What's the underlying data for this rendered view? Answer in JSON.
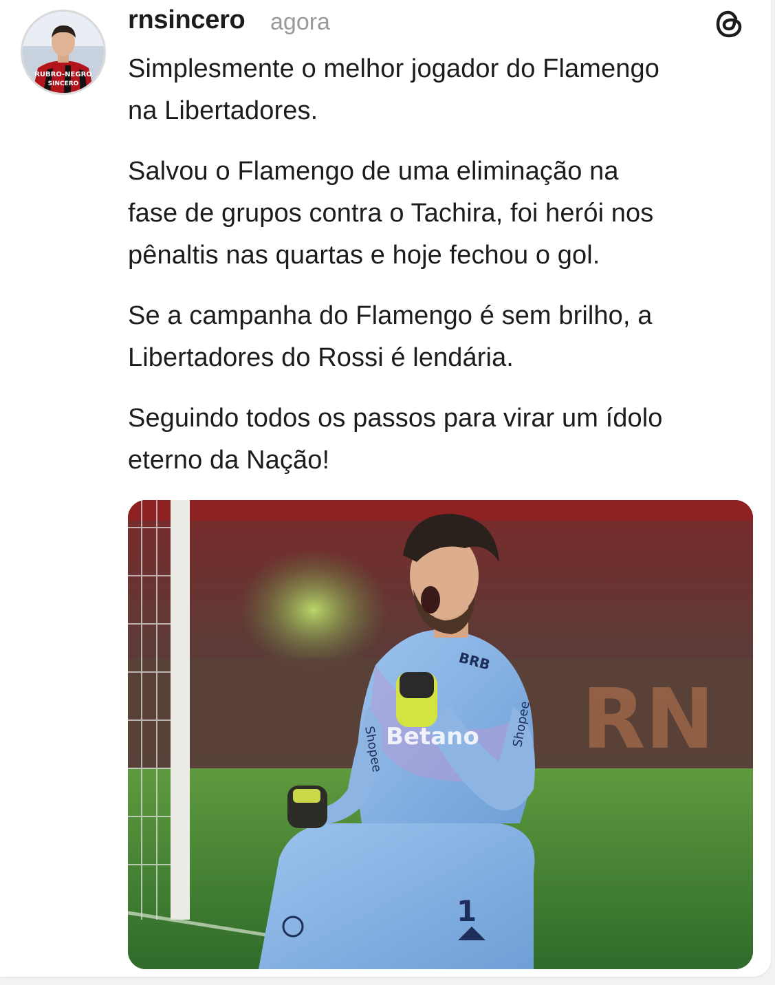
{
  "post": {
    "username": "rnsincero",
    "timestamp": "agora",
    "paragraphs": [
      "Simplesmente o melhor jogador do Flamengo\nna Libertadores.",
      "Salvou o Flamengo de uma eliminação na\nfase de grupos contra o Tachira, foi herói nos\npênaltis nas quartas e hoje fechou o gol.",
      "Se a campanha do Flamengo é sem brilho, a\nLibertadores do Rossi é lendária.",
      "Seguindo todos os passos para virar um ídolo\neterno da Nação!"
    ],
    "avatar_badge": [
      "RUBRO-NEGRO",
      "SINCERO"
    ],
    "app_icon": "threads-icon"
  },
  "photo": {
    "shirt_text": [
      "BRB",
      "Shopee",
      "Shopee",
      "Betano"
    ],
    "number": "1",
    "background_letters": "RN"
  },
  "colors": {
    "text": "#1c1c1c",
    "muted": "#9a9a9a",
    "kit": "#8fb7e4",
    "pitch": "#3f7d35"
  }
}
